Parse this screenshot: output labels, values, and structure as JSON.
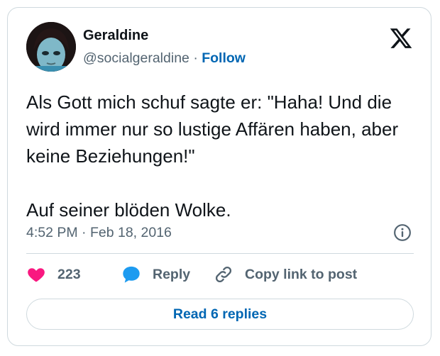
{
  "author": {
    "name": "Geraldine",
    "handle": "@socialgeraldine",
    "separator": "·",
    "follow_label": "Follow"
  },
  "tweet": {
    "text": "Als Gott mich schuf sagte er: \"Haha! Und die wird immer nur so lustige Affären haben, aber keine Beziehungen!\"\n\nAuf seiner blöden Wolke.",
    "time": "4:52 PM",
    "date_separator": "·",
    "date": "Feb 18, 2016"
  },
  "actions": {
    "like_count": "223",
    "reply_label": "Reply",
    "copy_link_label": "Copy link to post"
  },
  "replies_button_label": "Read 6 replies",
  "icons": {
    "like": "heart-icon",
    "reply": "speech-bubble-icon",
    "copy": "link-icon",
    "logo": "x-logo-icon",
    "info": "info-icon"
  },
  "colors": {
    "like": "#f91880",
    "reply": "#1d9bf0",
    "follow": "#0066b3",
    "muted": "#536471"
  }
}
